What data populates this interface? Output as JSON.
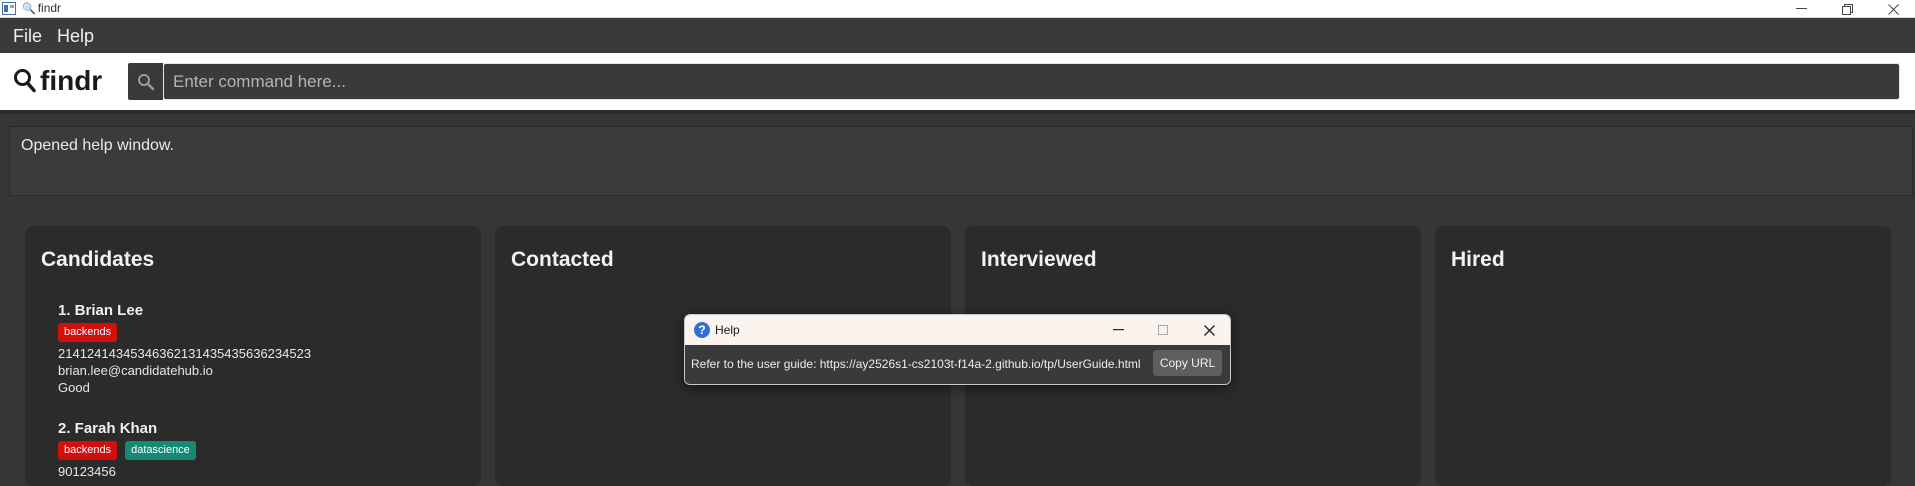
{
  "window": {
    "title": "findr",
    "app_icon": "app-window-icon",
    "controls": {
      "minimize": "minimize-icon",
      "maximize": "restore-icon",
      "close": "close-icon"
    }
  },
  "menu": {
    "file_label": "File",
    "help_label": "Help"
  },
  "brand": {
    "name": "findr",
    "icon": "magnifier-icon"
  },
  "command": {
    "placeholder": "Enter command here...",
    "value": "",
    "icon": "search-icon"
  },
  "result": {
    "text": "Opened help window."
  },
  "columns": [
    {
      "title": "Candidates",
      "cards": [
        {
          "name": "1. Brian Lee",
          "tags": [
            "backends"
          ],
          "phone": "21412414345346362131435435636234523",
          "email": "brian.lee@candidatehub.io",
          "note": "Good"
        },
        {
          "name": "2. Farah Khan",
          "tags": [
            "backends",
            "datascience"
          ],
          "phone": "90123456"
        }
      ]
    },
    {
      "title": "Contacted",
      "cards": []
    },
    {
      "title": "Interviewed",
      "cards": []
    },
    {
      "title": "Hired",
      "cards": []
    }
  ],
  "help_dialog": {
    "title": "Help",
    "message": "Refer to the user guide: https://ay2526s1-cs2103t-f14a-2.github.io/tp/UserGuide.html",
    "copy_button": "Copy URL"
  },
  "colors": {
    "tag_backends": "#d40d0d",
    "tag_datascience": "#148a77",
    "background": "#363636",
    "panel": "#2b2b2b"
  }
}
